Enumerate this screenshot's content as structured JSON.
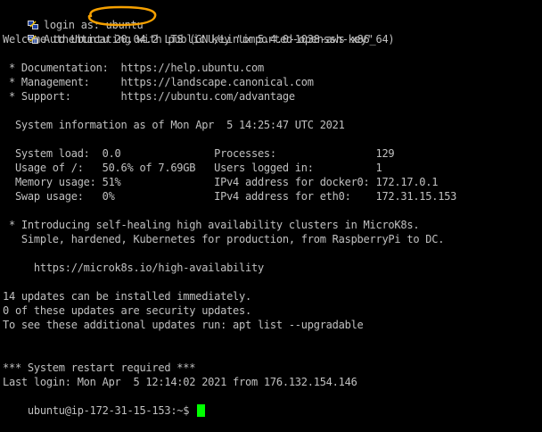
{
  "colors": {
    "background": "#000000",
    "text": "#c0c0c0",
    "cursor": "#00ff00",
    "annotation": "#f5a000"
  },
  "icons": {
    "line_prefix": "putty-key-icon"
  },
  "terminal": {
    "login_line": "login as: ubuntu",
    "auth_line": "Authenticating with public key \"imported-openssh-key\"",
    "welcome_line": "Welcome to Ubuntu 20.04.2 LTS (GNU/Linux 5.4.0-1038-aws x86_64)",
    "doc_line": " * Documentation:  https://help.ubuntu.com",
    "mgmt_line": " * Management:     https://landscape.canonical.com",
    "support_line": " * Support:        https://ubuntu.com/advantage",
    "sysinfo_line": "  System information as of Mon Apr  5 14:25:47 UTC 2021",
    "sysload_line": "  System load:  0.0               Processes:                129",
    "usage_line": "  Usage of /:   50.6% of 7.69GB   Users logged in:          1",
    "memory_line": "  Memory usage: 51%               IPv4 address for docker0: 172.17.0.1",
    "swap_line": "  Swap usage:   0%                IPv4 address for eth0:    172.31.15.153",
    "microk8s_line1": " * Introducing self-healing high availability clusters in MicroK8s.",
    "microk8s_line2": "   Simple, hardened, Kubernetes for production, from RaspberryPi to DC.",
    "microk8s_url": "     https://microk8s.io/high-availability",
    "updates_line1": "14 updates can be installed immediately.",
    "updates_line2": "0 of these updates are security updates.",
    "updates_line3": "To see these additional updates run: apt list --upgradable",
    "restart_line": "*** System restart required ***",
    "last_login_line": "Last login: Mon Apr  5 12:14:02 2021 from 176.132.154.146",
    "prompt": "ubuntu@ip-172-31-15-153:~$ "
  }
}
